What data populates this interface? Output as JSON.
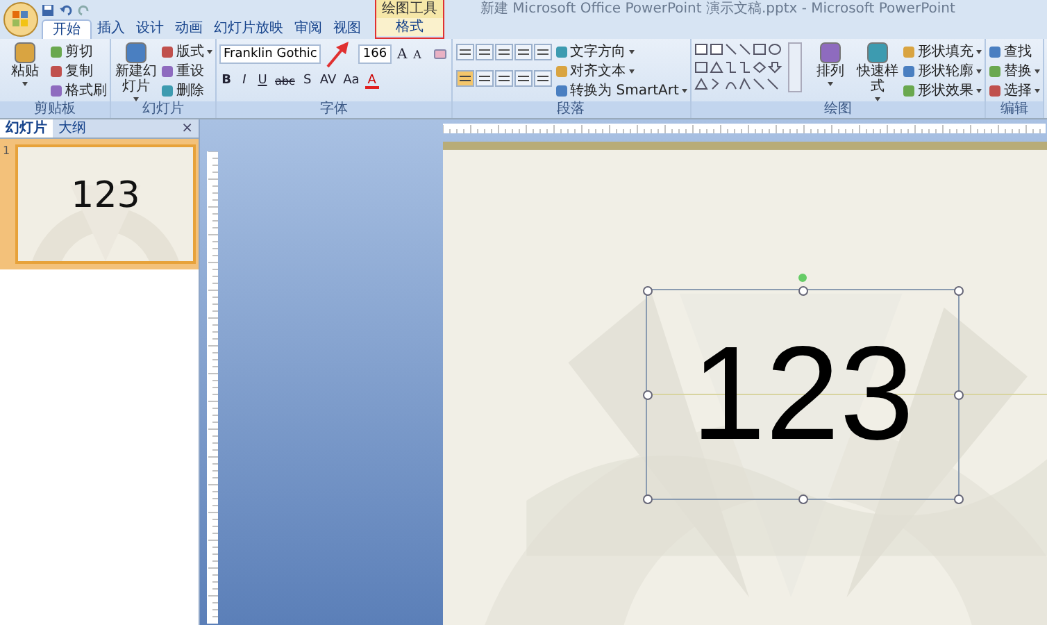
{
  "window": {
    "title": "新建 Microsoft Office PowerPoint 演示文稿.pptx - Microsoft PowerPoint",
    "contextual_group": "绘图工具"
  },
  "tabs": [
    {
      "label": "开始",
      "selected": true,
      "kind": "normal"
    },
    {
      "label": "插入",
      "selected": false,
      "kind": "normal"
    },
    {
      "label": "设计",
      "selected": false,
      "kind": "normal"
    },
    {
      "label": "动画",
      "selected": false,
      "kind": "normal"
    },
    {
      "label": "幻灯片放映",
      "selected": false,
      "kind": "normal"
    },
    {
      "label": "审阅",
      "selected": false,
      "kind": "normal"
    },
    {
      "label": "视图",
      "selected": false,
      "kind": "normal"
    },
    {
      "label": "格式",
      "selected": false,
      "kind": "contextual"
    }
  ],
  "groups": [
    {
      "label": "剪贴板",
      "kind": "standard",
      "large": [
        {
          "label": "粘贴",
          "dropdown": true
        }
      ],
      "small": [
        {
          "label": "剪切",
          "dropdown": false
        },
        {
          "label": "复制",
          "dropdown": false
        },
        {
          "label": "格式刷",
          "dropdown": false
        }
      ]
    },
    {
      "label": "幻灯片",
      "kind": "standard",
      "large": [
        {
          "label": "新建幻灯片",
          "dropdown": true
        }
      ],
      "small": [
        {
          "label": "版式",
          "dropdown": true
        },
        {
          "label": "重设",
          "dropdown": false
        },
        {
          "label": "删除",
          "dropdown": false
        }
      ]
    },
    {
      "label": "字体",
      "kind": "font",
      "font_name": "Franklin Gothic",
      "font_size": "166",
      "size_buttons": [
        "A",
        "A"
      ],
      "format_buttons": [
        "B",
        "I",
        "U",
        "abc",
        "S",
        "AV",
        "Aa",
        "A"
      ]
    },
    {
      "label": "段落",
      "kind": "paragraph",
      "small": [
        {
          "label": "文字方向",
          "dropdown": true
        },
        {
          "label": "对齐文本",
          "dropdown": true
        },
        {
          "label": "转换为 SmartArt",
          "dropdown": true
        }
      ]
    },
    {
      "label": "绘图",
      "kind": "drawing",
      "large": [
        {
          "label": "排列",
          "dropdown": true
        },
        {
          "label": "快速样式",
          "dropdown": true
        }
      ],
      "small": [
        {
          "label": "形状填充",
          "dropdown": true
        },
        {
          "label": "形状轮廓",
          "dropdown": true
        },
        {
          "label": "形状效果",
          "dropdown": true
        }
      ]
    },
    {
      "label": "编辑",
      "kind": "standard",
      "small": [
        {
          "label": "查找",
          "dropdown": false
        },
        {
          "label": "替换",
          "dropdown": true
        },
        {
          "label": "选择",
          "dropdown": true
        }
      ]
    }
  ],
  "pane": {
    "tabs": [
      {
        "label": "幻灯片",
        "selected": true
      },
      {
        "label": "大纲",
        "selected": false
      }
    ],
    "close": "×",
    "thumbnails": [
      {
        "number": "1",
        "text": "123",
        "selected": true
      }
    ]
  },
  "slide": {
    "text": "123",
    "selected": true
  }
}
